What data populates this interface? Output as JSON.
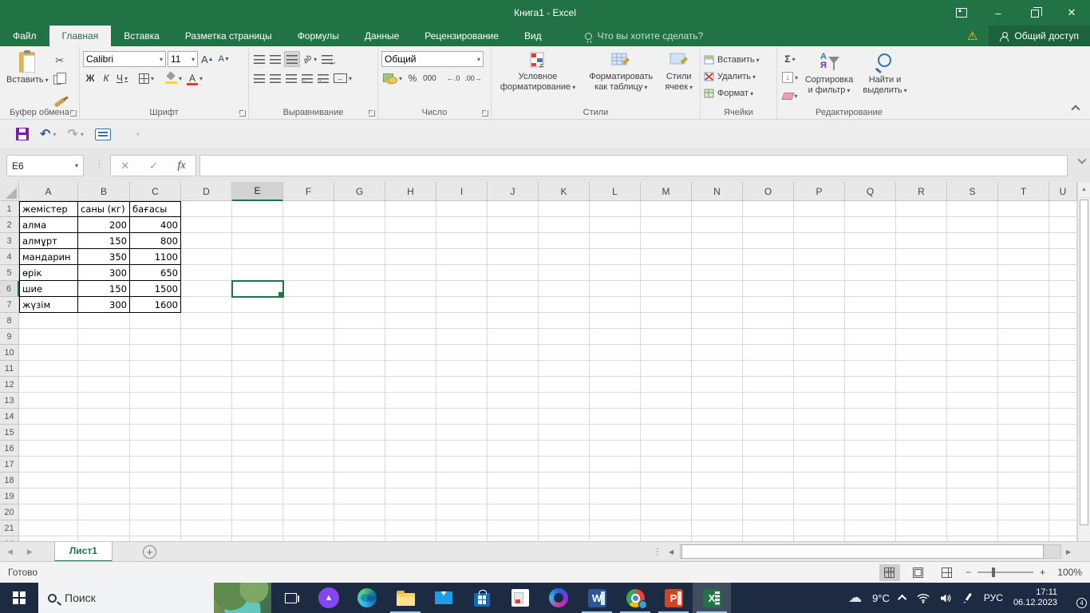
{
  "colors": {
    "excel_green": "#217346",
    "taskbar": "#1c2b41",
    "warning": "#f2c24b",
    "selection": "#217346"
  },
  "window": {
    "title": "Книга1 - Excel"
  },
  "tabs": {
    "file": "Файл",
    "items": [
      "Главная",
      "Вставка",
      "Разметка страницы",
      "Формулы",
      "Данные",
      "Рецензирование",
      "Вид"
    ],
    "active": "Главная",
    "tellme": "Что вы хотите сделать?",
    "share": "Общий доступ"
  },
  "ribbon": {
    "paste": "Вставить",
    "font_name": "Calibri",
    "font_size": "11",
    "bold": "Ж",
    "italic": "К",
    "underline": "Ч",
    "number_format": "Общий",
    "percent": "%",
    "thousands": "000",
    "inc_decimal": "←.0",
    "dec_decimal": ".00→",
    "cond_format": "Условное форматирование",
    "format_table": "Форматировать как таблицу",
    "cell_styles": "Стили ячеек",
    "insert": "Вставить",
    "delete": "Удалить",
    "format": "Формат",
    "autosum": "Σ",
    "sort_a": "А",
    "sort_b": "Я",
    "sort_filter": "Сортировка и фильтр",
    "find_select": "Найти и выделить",
    "groups": {
      "clipboard": "Буфер обмена",
      "font": "Шрифт",
      "alignment": "Выравнивание",
      "number": "Число",
      "styles": "Стили",
      "cells": "Ячейки",
      "editing": "Редактирование"
    }
  },
  "formula_bar": {
    "name_box": "E6",
    "fx": "fx",
    "value": ""
  },
  "grid": {
    "columns": [
      "A",
      "B",
      "C",
      "D",
      "E",
      "F",
      "G",
      "H",
      "I",
      "J",
      "K",
      "L",
      "M",
      "N",
      "O",
      "P",
      "Q",
      "R",
      "S",
      "T",
      "U"
    ],
    "col_widths": {
      "default": 64,
      "A": 74,
      "B": 65,
      "U": 35
    },
    "row_count": 22,
    "selected_cell": "E6",
    "selected_column": "E",
    "selected_row": 6,
    "table": {
      "headers": [
        "жемістер",
        "саны (кг)",
        "бағасы"
      ],
      "rows": [
        [
          "алма",
          "200",
          "400"
        ],
        [
          "алмұрт",
          "150",
          "800"
        ],
        [
          "мандарин",
          "350",
          "1100"
        ],
        [
          "өрік",
          "300",
          "650"
        ],
        [
          "шие",
          "150",
          "1500"
        ],
        [
          "жүзім",
          "300",
          "1600"
        ]
      ]
    }
  },
  "sheet_bar": {
    "tab": "Лист1"
  },
  "status_bar": {
    "mode": "Готово",
    "zoom": "100%",
    "zoom_minus": "−",
    "zoom_plus": "+"
  },
  "taskbar": {
    "search_placeholder": "Поиск",
    "temperature": "9°C",
    "language": "РУС",
    "time": "17:11",
    "date": "06.12.2023",
    "notification_count": "4"
  },
  "glyphs": {
    "warning": "⚠",
    "undo": "↶",
    "redo": "↷",
    "minimize": "–",
    "close": "✕",
    "cancel": "✕",
    "enter": "✓",
    "cut": "✂",
    "nav_left": "◀",
    "nav_right": "▶",
    "scroll_up": "▲",
    "scroll_left": "◀",
    "scroll_right": "▶",
    "dots": "⋮",
    "plus_sheet": "+"
  }
}
